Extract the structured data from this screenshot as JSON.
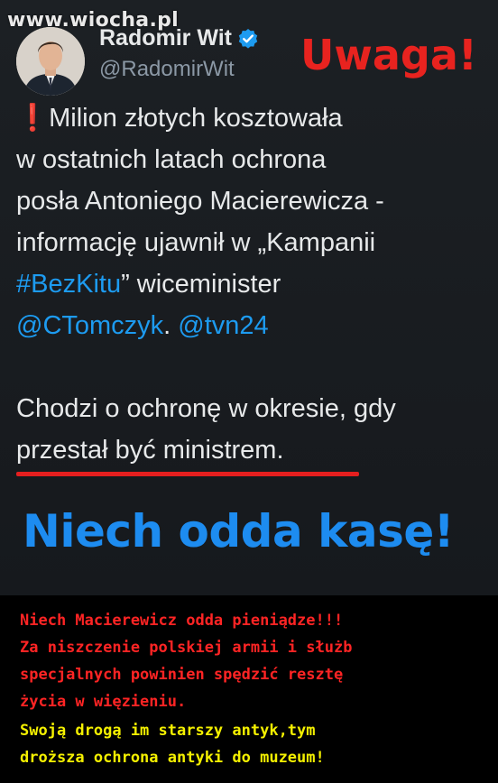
{
  "watermark": "www.wiocha.pl",
  "tweet": {
    "author_name": "Radomir Wit",
    "author_handle": "@RadomirWit",
    "overlay_label": "Uwaga!",
    "lines": [
      "Milion złotych kosztowała",
      "w ostatnich latach ochrona",
      "posła Antoniego Macierewicza -",
      "informację ujawnił w „Kampanii"
    ],
    "hashtag": "#BezKitu",
    "line5_rest": "” wiceminister",
    "mention1": "@CTomczyk",
    "mention_sep": ". ",
    "mention2": "@tvn24",
    "para2": [
      "Chodzi o ochronę w okresie, gdy",
      "przestał być ministrem."
    ]
  },
  "headline": "Niech odda kasę!",
  "caption": {
    "red_lines": [
      "Niech Macierewicz odda pieniądze!!!",
      "Za niszczenie polskiej armii i służb",
      "specjalnych powinien spędzić resztę",
      "życia w więzieniu."
    ],
    "yellow_lines": [
      "Swoją drogą im starszy antyk,tym",
      "droższa ochrona antyki do muzeum!"
    ]
  },
  "colors": {
    "accent_blue": "#1d9bf0",
    "alert_red": "#e8231f",
    "caption_yellow": "#f4f000"
  }
}
